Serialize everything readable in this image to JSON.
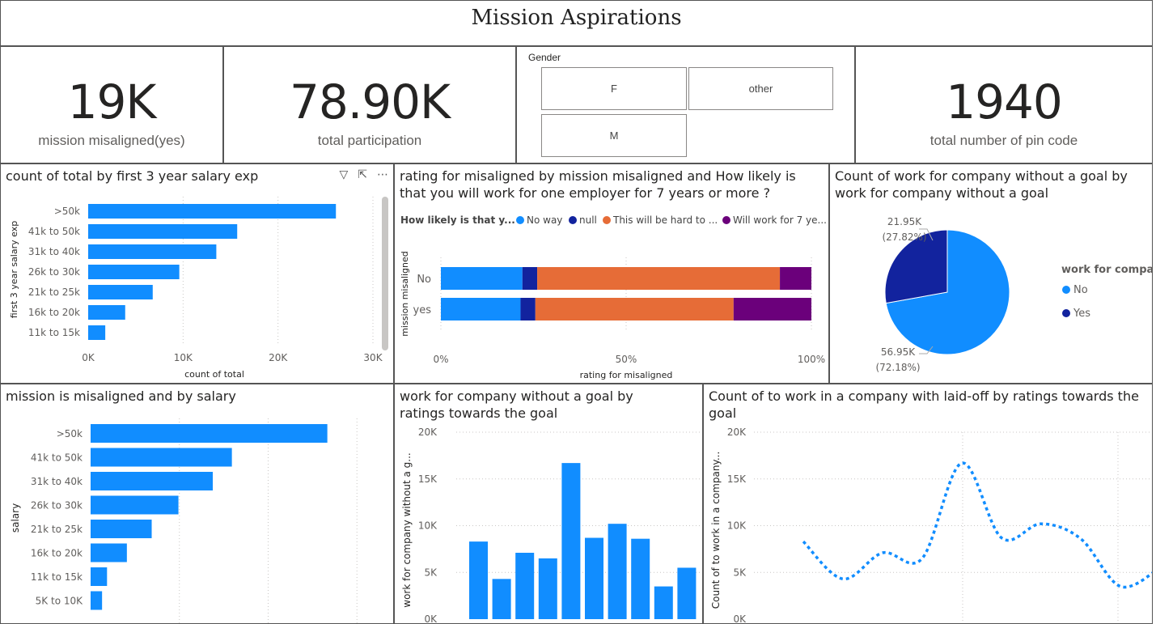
{
  "page_title": "Mission Aspirations",
  "kpis": [
    {
      "value": "19K",
      "label": "mission misaligned(yes)"
    },
    {
      "value": "78.90K",
      "label": "total participation"
    },
    {
      "value": "1940",
      "label": "total number of pin code"
    }
  ],
  "slicer": {
    "title": "Gender",
    "options": [
      "F",
      "other",
      "M"
    ]
  },
  "header_icons": [
    "filter-icon",
    "focus-mode-icon",
    "more-options-icon"
  ],
  "colors": {
    "primary_blue": "#118DFF",
    "dark_blue": "#12239E",
    "orange": "#E66C37",
    "purple": "#6B007B"
  },
  "chart_data": [
    {
      "type": "bar",
      "orientation": "horizontal",
      "title": "count of total by first 3 year salary exp",
      "xlabel": "count of total",
      "ylabel": "first 3 year salary exp",
      "categories": [
        ">50k",
        "41k to 50k",
        "31k to 40k",
        "26k to 30k",
        "21k to 25k",
        "16k to 20k",
        "11k to 15k"
      ],
      "values": [
        26100,
        15700,
        13500,
        9600,
        6800,
        3900,
        1800
      ],
      "xlim": [
        0,
        30000
      ],
      "xticks": [
        "0K",
        "10K",
        "20K",
        "30K"
      ],
      "grid": true
    },
    {
      "type": "bar",
      "orientation": "horizontal",
      "stacked": "100%",
      "title": "rating for misaligned by mission misaligned and How likely is that you will work for one employer for 7 years or more ?",
      "xlabel": "rating for misaligned",
      "ylabel": "mission misaligned",
      "legend_title": "How likely is that y...",
      "legend_position": "top",
      "categories": [
        "No",
        "yes"
      ],
      "series": [
        {
          "name": "No way",
          "values": [
            22,
            21.5
          ]
        },
        {
          "name": "null",
          "values": [
            4,
            4
          ]
        },
        {
          "name": "This will be hard to ...",
          "values": [
            65.5,
            53.5
          ]
        },
        {
          "name": "Will work for 7 ye...",
          "values": [
            8.5,
            21
          ]
        }
      ],
      "xticks": [
        "0%",
        "50%",
        "100%"
      ]
    },
    {
      "type": "pie",
      "title": "Count of work for company without a goal by work for company without a goal",
      "legend_title": "work for compa",
      "legend_position": "right",
      "slices": [
        {
          "name": "No",
          "value": 56950,
          "label": "56.95K",
          "percent_label": "(72.18%)"
        },
        {
          "name": "Yes",
          "value": 21950,
          "label": "21.95K",
          "percent_label": "(27.82%)"
        }
      ]
    },
    {
      "type": "bar",
      "orientation": "horizontal",
      "title": "mission is misaligned and by salary",
      "ylabel": "salary",
      "categories": [
        ">50k",
        "41k to 50k",
        "31k to 40k",
        "26k to 30k",
        "21k to 25k",
        "16k to 20k",
        "11k to 15k",
        "5K to 10K"
      ],
      "values": [
        6200,
        3700,
        3200,
        2300,
        1600,
        950,
        430,
        300
      ],
      "xlim": [
        0,
        7500
      ],
      "grid": true
    },
    {
      "type": "bar",
      "title": "work for company without a goal by ratings towards the goal",
      "ylabel": "work for company without a g...",
      "values": [
        8300,
        4300,
        7100,
        6500,
        16700,
        8700,
        10200,
        8600,
        3500,
        5500
      ],
      "ylim": [
        0,
        20000
      ],
      "yticks": [
        "0K",
        "5K",
        "10K",
        "15K",
        "20K"
      ]
    },
    {
      "type": "line",
      "style": "dotted",
      "title": "Count of to work in a company with laid-off by ratings towards the goal",
      "ylabel": "Count of to work in a company...",
      "values": [
        8300,
        4300,
        7100,
        6500,
        16700,
        8700,
        10200,
        8600,
        3500,
        5500
      ],
      "ylim": [
        0,
        20000
      ],
      "yticks": [
        "0K",
        "5K",
        "10K",
        "15K",
        "20K"
      ]
    }
  ]
}
